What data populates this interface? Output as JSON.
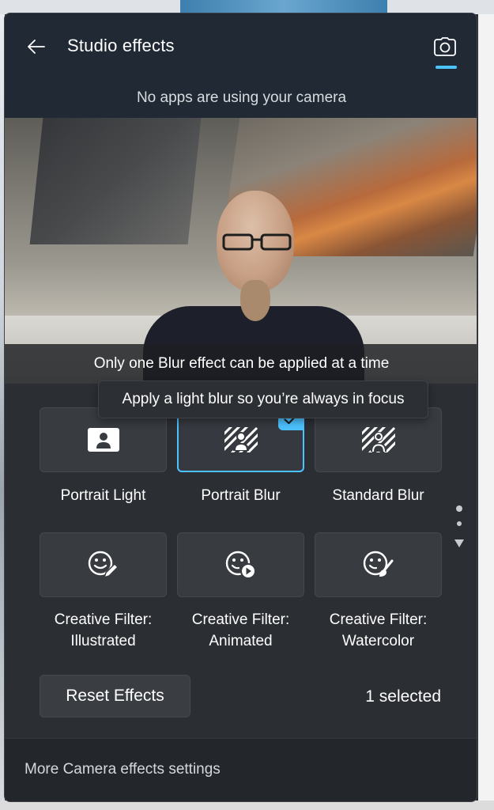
{
  "header": {
    "title": "Studio effects",
    "back_icon": "arrow-left-icon",
    "camera_icon": "camera-icon",
    "status": "No apps are using your camera"
  },
  "preview": {
    "note": "Only one Blur effect can be applied at a time"
  },
  "tooltip": "Apply a light blur so you’re always in focus",
  "effects": [
    {
      "label": "Portrait Light",
      "icon": "portrait-light-icon",
      "selected": false
    },
    {
      "label": "Portrait Blur",
      "icon": "portrait-blur-icon",
      "selected": true
    },
    {
      "label": "Standard Blur",
      "icon": "standard-blur-icon",
      "selected": false
    },
    {
      "label_line1": "Creative Filter:",
      "label_line2": "Illustrated",
      "icon": "smiley-pen-icon",
      "selected": false
    },
    {
      "label_line1": "Creative Filter:",
      "label_line2": "Animated",
      "icon": "smiley-play-icon",
      "selected": false
    },
    {
      "label_line1": "Creative Filter:",
      "label_line2": "Watercolor",
      "icon": "smiley-brush-icon",
      "selected": false
    }
  ],
  "footer_controls": {
    "reset_label": "Reset Effects",
    "selected_count": "1 selected"
  },
  "footer": {
    "link": "More Camera effects settings"
  },
  "colors": {
    "accent": "#4cc2ff",
    "panel": "#2b2e33",
    "header": "#212a34"
  }
}
